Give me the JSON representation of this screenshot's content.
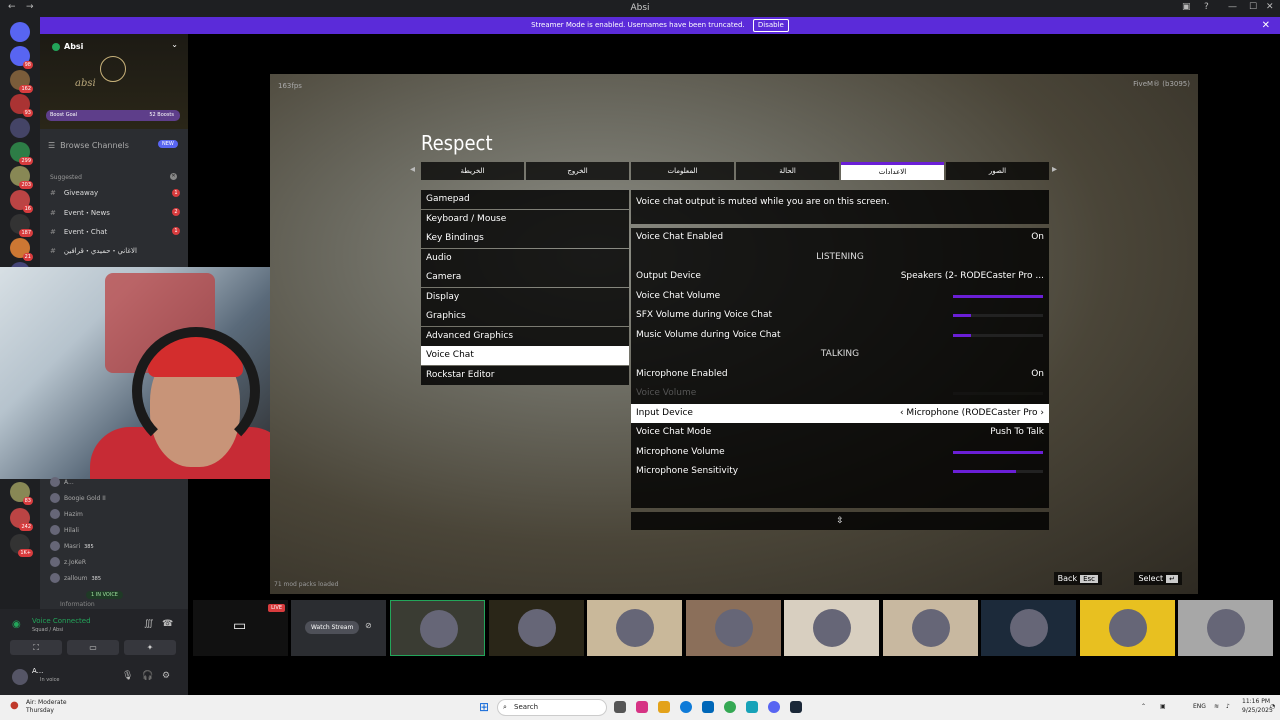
{
  "window": {
    "title": "Absi",
    "min": "—",
    "max": "☐",
    "close": "✕"
  },
  "banner": {
    "text": "Streamer Mode is enabled. Usernames have been truncated.",
    "button": "Disable",
    "close": "✕"
  },
  "server_badges": [
    "98",
    "162",
    "93",
    "",
    "299",
    "203",
    "16",
    "187",
    "21",
    "307"
  ],
  "server_badges_lower": [
    "83",
    "242",
    "1K+"
  ],
  "server": {
    "name": "Absi",
    "signature": "absi",
    "boost_label": "Boost Goal",
    "boost_count": "52 Boosts"
  },
  "browse": {
    "label": "Browse Channels",
    "badge": "NEW"
  },
  "suggested": {
    "label": "Suggested",
    "close": "✕"
  },
  "channels": [
    {
      "name": "Giveaway",
      "badge": "1"
    },
    {
      "name": "Event・News",
      "badge": "2"
    },
    {
      "name": "Event・Chat",
      "badge": "1"
    },
    {
      "name": "الاغاني・حميدي・قرافين",
      "badge": ""
    }
  ],
  "members": [
    {
      "name": "A...",
      "tag": ""
    },
    {
      "name": "Boogie Gold II",
      "tag": ""
    },
    {
      "name": "Hazim",
      "tag": ""
    },
    {
      "name": "Hilali",
      "tag": ""
    },
    {
      "name": "Masri",
      "tag": "385"
    },
    {
      "name": "z.JoKeR",
      "tag": ""
    },
    {
      "name": "zalloum",
      "tag": "385"
    }
  ],
  "in_voice_badge": "1 IN VOICE",
  "info_channel": "Information",
  "voice": {
    "status": "Voice Connected",
    "sub": "Squad / Absi"
  },
  "user": {
    "name": "A...",
    "status": "In voice"
  },
  "game": {
    "fps": "163fps",
    "fivem": "FiveM® (b3095)",
    "mods": "71 mod packs loaded",
    "brand": "Respect",
    "tabs": [
      "الخريطة",
      "الخروج",
      "المعلومات",
      "الحالة",
      "الاعدادات",
      "الصور"
    ],
    "active_tab": 4,
    "categories": [
      "Gamepad",
      "Keyboard / Mouse",
      "Key Bindings",
      "Audio",
      "Camera",
      "Display",
      "Graphics",
      "Advanced Graphics",
      "Voice Chat",
      "Rockstar Editor"
    ],
    "active_category": 8,
    "note": "Voice chat output is muted while you are on this screen.",
    "rows": [
      {
        "label": "Voice Chat Enabled",
        "value": "On",
        "kind": "value"
      },
      {
        "label": "LISTENING",
        "kind": "header"
      },
      {
        "label": "Output Device",
        "value": "Speakers (2- RODECaster Pro ...",
        "kind": "value"
      },
      {
        "label": "Voice Chat Volume",
        "level": 1.0,
        "kind": "bar"
      },
      {
        "label": "SFX Volume during Voice Chat",
        "level": 0.2,
        "kind": "bar"
      },
      {
        "label": "Music Volume during Voice Chat",
        "level": 0.2,
        "kind": "bar"
      },
      {
        "label": "TALKING",
        "kind": "header"
      },
      {
        "label": "Microphone Enabled",
        "value": "On",
        "kind": "value"
      },
      {
        "label": "Voice Volume",
        "level": 0.0,
        "kind": "dim"
      },
      {
        "label": "Input Device",
        "value": "‹ Microphone (RODECaster Pro ›",
        "kind": "selected"
      },
      {
        "label": "Voice Chat Mode",
        "value": "Push To Talk",
        "kind": "value"
      },
      {
        "label": "Microphone Volume",
        "level": 1.0,
        "kind": "bar"
      },
      {
        "label": "Microphone Sensitivity",
        "level": 0.7,
        "kind": "bar"
      }
    ],
    "back_label": "Back",
    "back_key": "Esc",
    "select_label": "Select",
    "select_key": "↵"
  },
  "strip": {
    "live": "LIVE",
    "watch": "Watch Stream"
  },
  "taskbar": {
    "weather": "Air: Moderate",
    "day": "Thursday",
    "search": "Search",
    "lang": "ENG",
    "time": "11:16 PM",
    "date": "9/25/2025"
  },
  "colors": {
    "accent": "#6a1fd6",
    "banner": "#5b2bd9",
    "online": "#23a55a",
    "badge": "#d83c3e"
  }
}
